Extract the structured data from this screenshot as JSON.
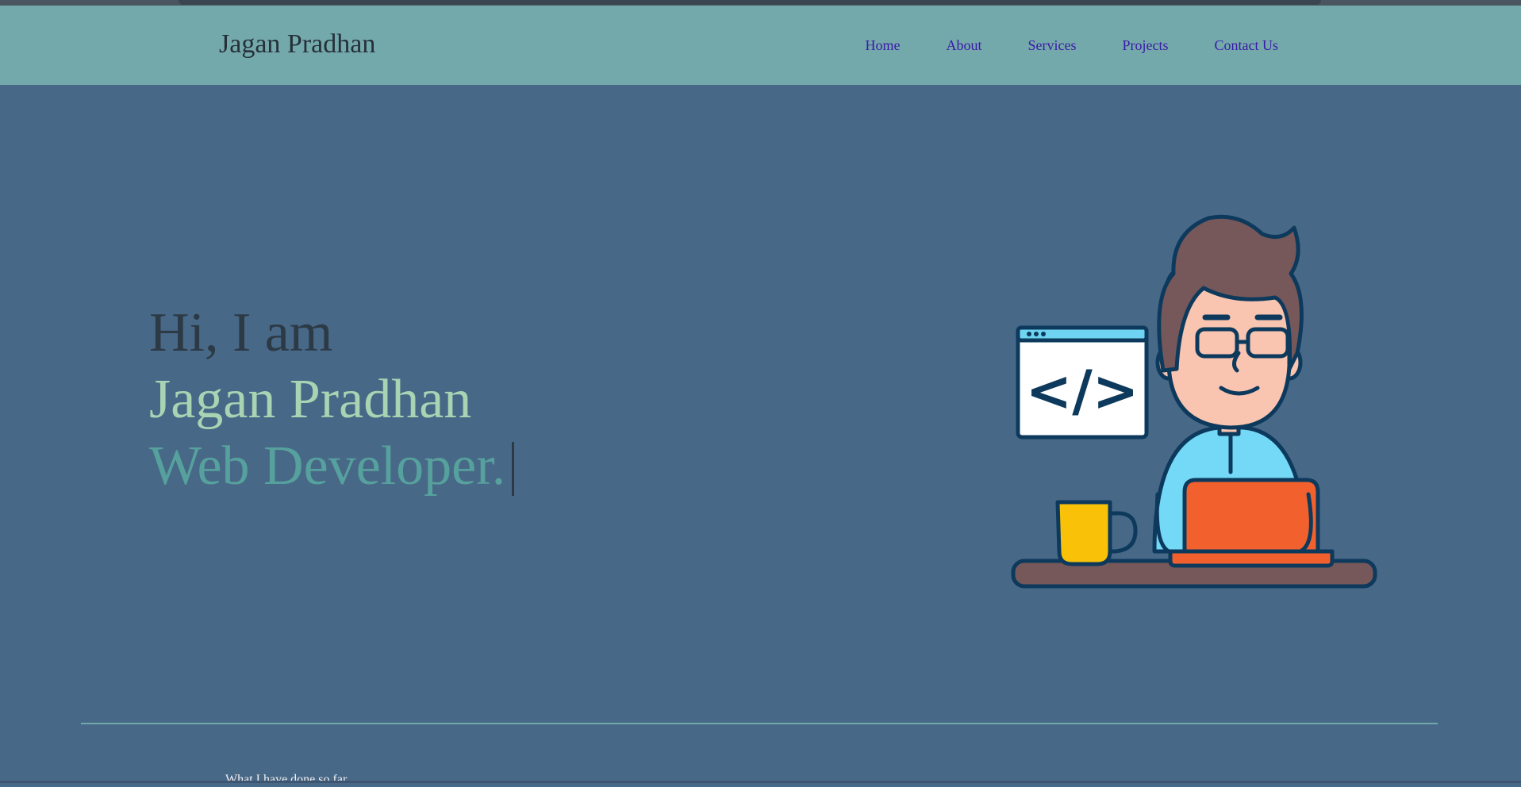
{
  "brand": {
    "name": "Jagan Pradhan"
  },
  "nav": {
    "items": [
      {
        "label": "Home"
      },
      {
        "label": "About"
      },
      {
        "label": "Services"
      },
      {
        "label": "Projects"
      },
      {
        "label": "Contact Us"
      }
    ]
  },
  "hero": {
    "greeting": "Hi, I am",
    "name": "Jagan Pradhan",
    "role": "Web Developer."
  },
  "illustration": {
    "code_tag": "</>",
    "icon": "developer-at-laptop-illustration"
  },
  "section_teaser": {
    "text": "What I have done so far"
  },
  "colors": {
    "background": "#486887",
    "navbar": "#74a9ab",
    "nav_link": "#3a1aa8",
    "name_accent": "#a9d3b3",
    "role_accent": "#56a19d",
    "divider": "#6fa9a8"
  }
}
